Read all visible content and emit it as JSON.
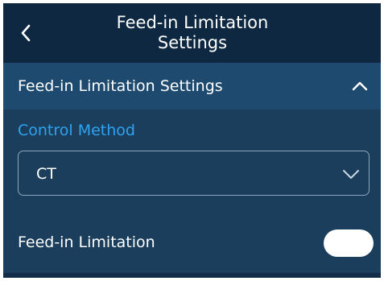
{
  "header": {
    "title_line1": "Feed-in Limitation",
    "title_line2": "Settings",
    "back_icon": "chevron-left-icon"
  },
  "section": {
    "label": "Feed-in Limitation Settings",
    "collapse_icon": "chevron-up-icon",
    "expanded": true
  },
  "control_method": {
    "label": "Control Method",
    "selected": "CT",
    "dropdown_icon": "chevron-down-icon"
  },
  "feed_in_limitation": {
    "label": "Feed-in Limitation",
    "toggle_icon": "toggle-switch"
  },
  "colors": {
    "header_bg": "#0d2840",
    "section_bg": "#1d4a6e",
    "body_bg": "#1a3e5c",
    "accent": "#2fa3f0",
    "text": "#ffffff"
  }
}
